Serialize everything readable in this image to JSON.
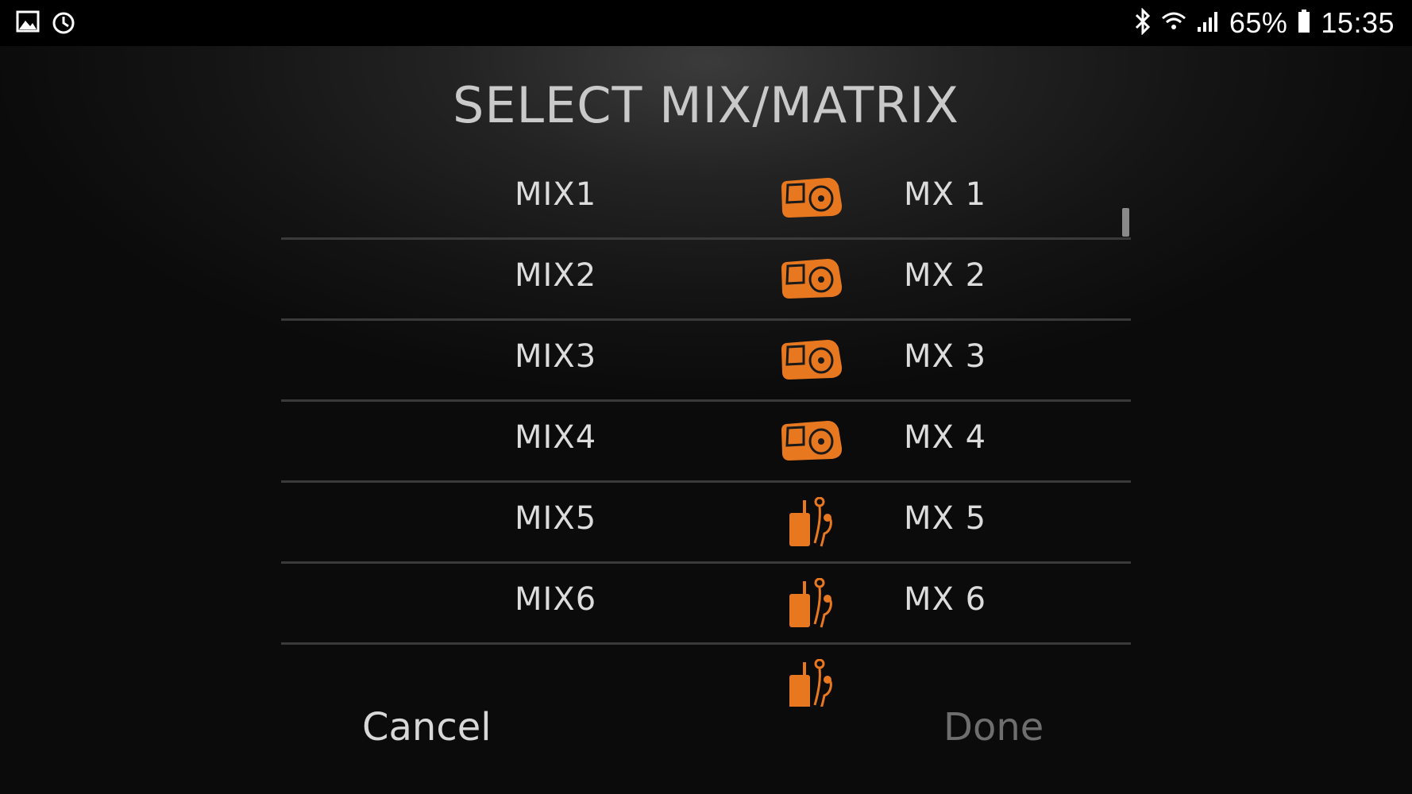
{
  "status_bar": {
    "left_icons": [
      "gallery-icon",
      "sync-icon"
    ],
    "battery_percent": "65%",
    "time": "15:35",
    "right_icons": [
      "bluetooth-icon",
      "wifi-icon",
      "signal-icon",
      "battery-icon"
    ]
  },
  "dialog": {
    "title": "SELECT MIX/MATRIX",
    "rows": [
      {
        "mix": "MIX1",
        "icon": "floor-monitor-icon",
        "name": "MX 1"
      },
      {
        "mix": "MIX2",
        "icon": "floor-monitor-icon",
        "name": "MX 2"
      },
      {
        "mix": "MIX3",
        "icon": "floor-monitor-icon",
        "name": "MX 3"
      },
      {
        "mix": "MIX4",
        "icon": "floor-monitor-icon",
        "name": "MX 4"
      },
      {
        "mix": "MIX5",
        "icon": "in-ear-monitor-icon",
        "name": "MX 5"
      },
      {
        "mix": "MIX6",
        "icon": "in-ear-monitor-icon",
        "name": "MX 6"
      },
      {
        "mix": "",
        "icon": "in-ear-monitor-icon",
        "name": ""
      }
    ],
    "cancel_label": "Cancel",
    "done_label": "Done"
  },
  "colors": {
    "accent": "#e8781f",
    "text": "#dcdcdc",
    "divider": "#3a3a3a",
    "done_disabled": "#6e6e6e"
  }
}
